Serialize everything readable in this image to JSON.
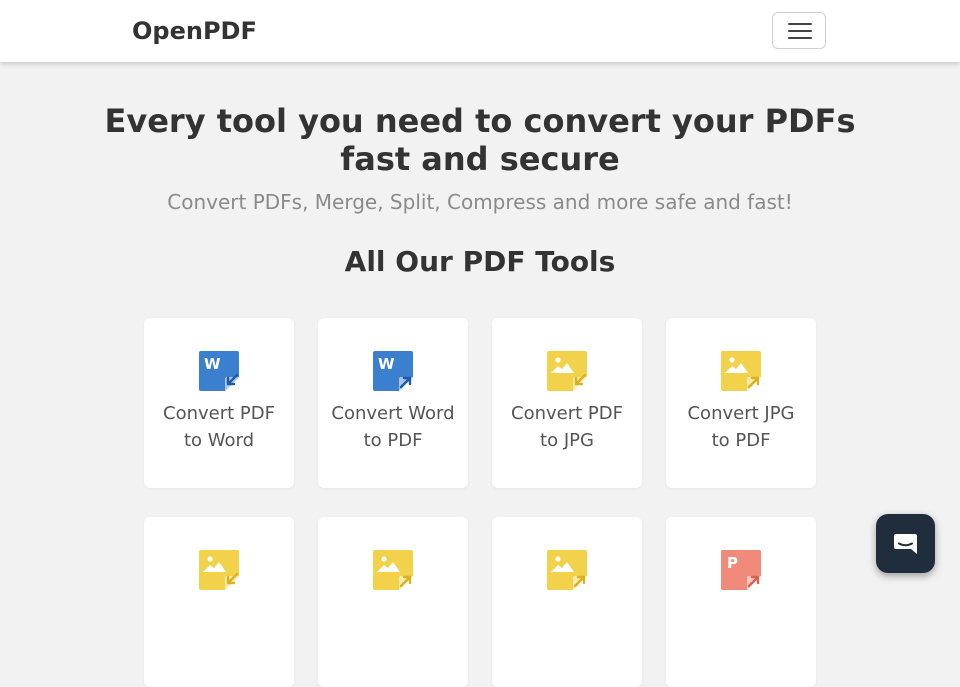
{
  "navbar": {
    "brand": "OpenPDF",
    "menu_icon": "hamburger-menu-icon"
  },
  "hero": {
    "title": "Every tool you need to convert your PDFs fast and secure",
    "subtitle": "Convert PDFs, Merge, Split, Compress and more safe and fast!"
  },
  "tools_section": {
    "title": "All Our PDF Tools",
    "tools": [
      {
        "label": "Convert PDF to Word",
        "icon": "word-doc-icon",
        "color": "#3b7fcf",
        "direction": "in"
      },
      {
        "label": "Convert Word to PDF",
        "icon": "word-doc-icon",
        "color": "#3b7fcf",
        "direction": "out"
      },
      {
        "label": "Convert PDF to JPG",
        "icon": "image-doc-icon",
        "color": "#f2d24b",
        "direction": "in"
      },
      {
        "label": "Convert JPG to PDF",
        "icon": "image-doc-icon",
        "color": "#f2d24b",
        "direction": "out"
      },
      {
        "label": "",
        "icon": "image-doc-icon",
        "color": "#f2d24b",
        "direction": "in"
      },
      {
        "label": "",
        "icon": "image-doc-icon",
        "color": "#f2d24b",
        "direction": "out"
      },
      {
        "label": "",
        "icon": "image-doc-icon",
        "color": "#f2d24b",
        "direction": "out"
      },
      {
        "label": "",
        "icon": "powerpoint-doc-icon",
        "color": "#f08a7a",
        "direction": "out"
      }
    ]
  },
  "chat": {
    "icon": "chat-bubble-icon",
    "color": "#1f2d3d"
  }
}
